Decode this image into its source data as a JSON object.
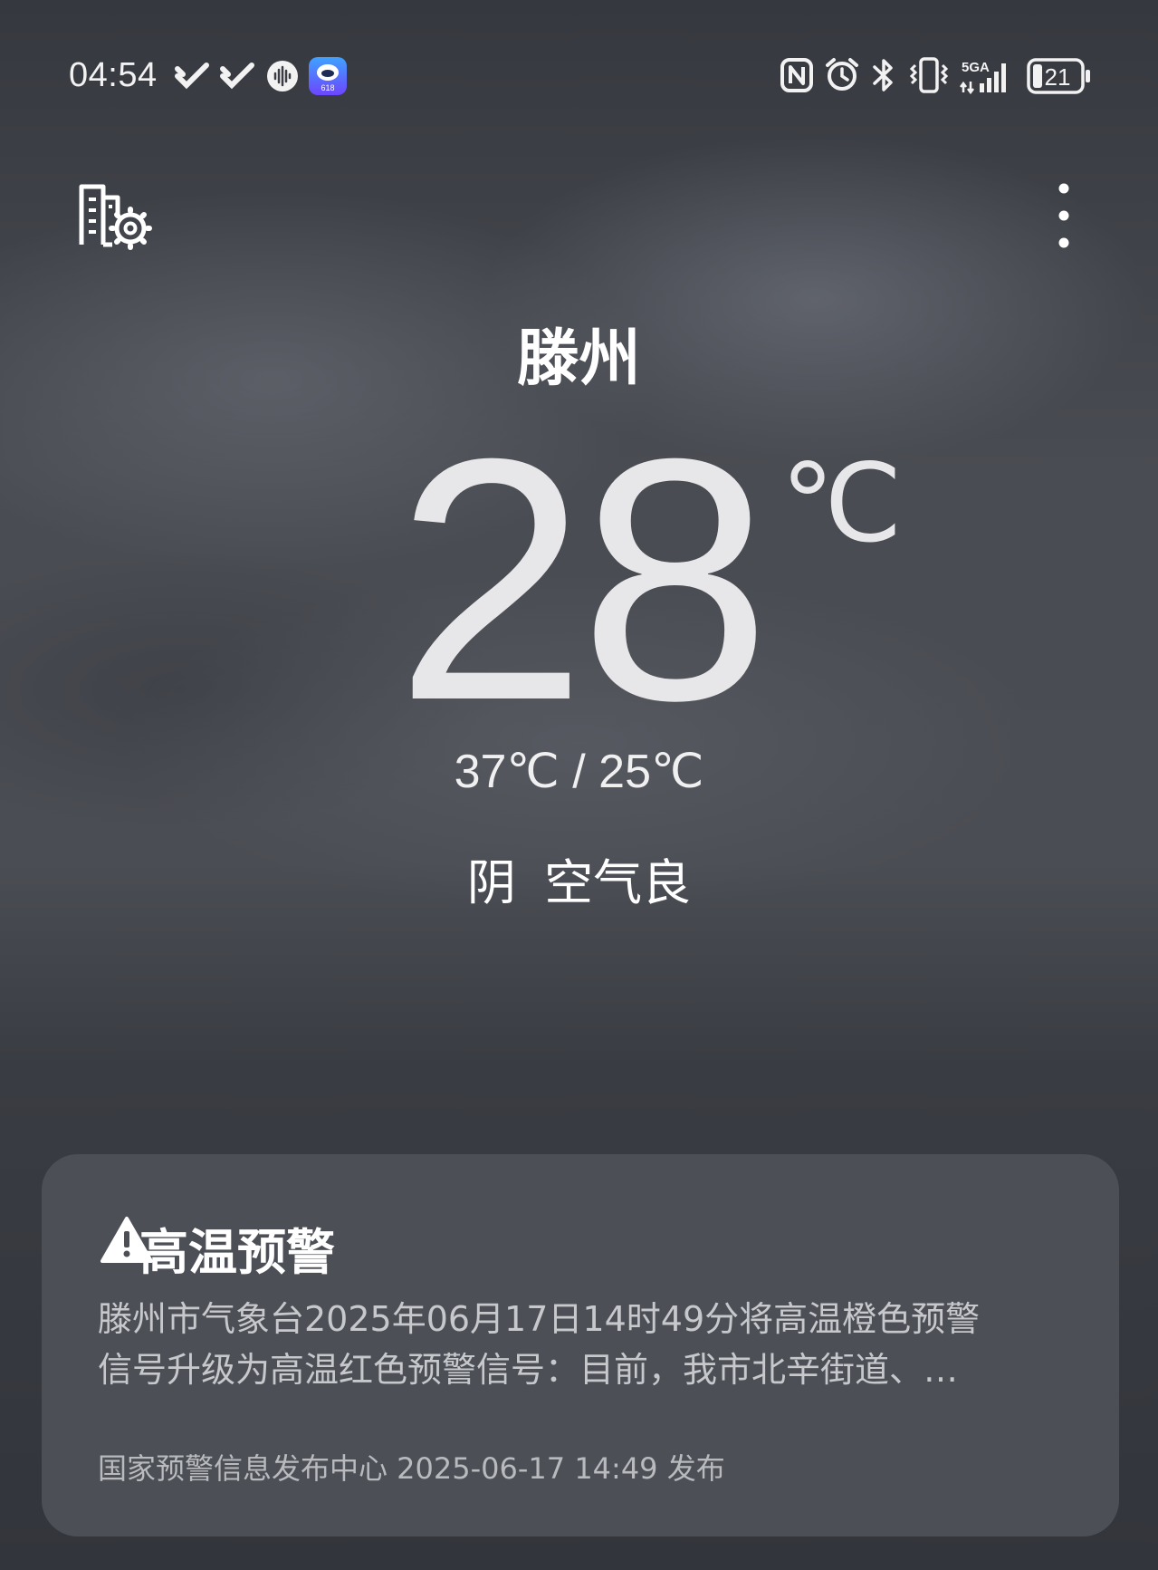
{
  "status_bar": {
    "time": "04:54",
    "app_badge": "618",
    "battery": "21",
    "network": "5GA"
  },
  "toolbar": {
    "left_icon": "city-settings-icon",
    "right_icon": "more-vert-icon"
  },
  "weather": {
    "city": "滕州",
    "temperature": "28",
    "unit": "℃",
    "range": "37℃ / 25℃",
    "condition": "阴",
    "air_quality": "空气良"
  },
  "alert": {
    "title": "高温预警",
    "line1": "滕州市气象台2025年06月17日14时49分将高温橙色预警",
    "line2": "信号升级为高温红色预警信号：目前，我市北辛街道、…",
    "source": "国家预警信息发布中心 2025-06-17 14:49 发布"
  }
}
